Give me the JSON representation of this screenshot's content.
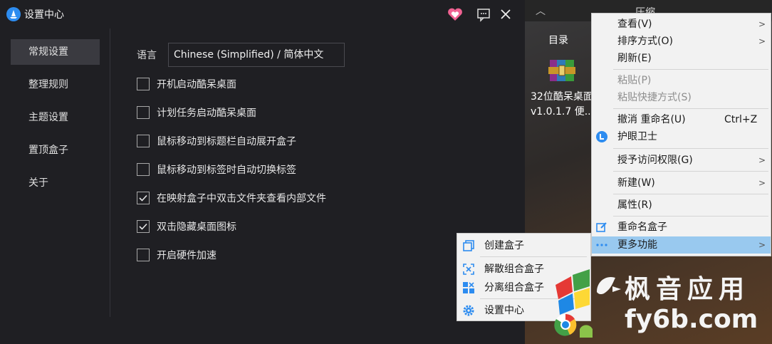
{
  "window": {
    "title": "设置中心"
  },
  "sidebar": {
    "items": [
      {
        "label": "常规设置",
        "active": true
      },
      {
        "label": "整理规则"
      },
      {
        "label": "主题设置"
      },
      {
        "label": "置顶盒子"
      },
      {
        "label": "关于"
      }
    ]
  },
  "settings": {
    "language_label": "语言",
    "language_value": "Chinese (Simplified) / 简体中文",
    "options": [
      {
        "label": "开机启动酷呆桌面",
        "checked": false
      },
      {
        "label": "计划任务启动酷呆桌面",
        "checked": false
      },
      {
        "label": "鼠标移动到标题栏自动展开盒子",
        "checked": false
      },
      {
        "label": "鼠标移动到标签时自动切换标签",
        "checked": false
      },
      {
        "label": "在映射盒子中双击文件夹查看内部文件",
        "checked": true
      },
      {
        "label": "双击隐藏桌面图标",
        "checked": true
      },
      {
        "label": "开启硬件加速",
        "checked": false
      }
    ]
  },
  "desktop": {
    "box_title": "压缩",
    "dir_label": "目录",
    "file_label_line1": "32位酷呆桌面",
    "file_label_line2": "v1.0.1.7 便..."
  },
  "context_menu": {
    "view": "查看(V)",
    "sort": "排序方式(O)",
    "refresh": "刷新(E)",
    "paste": "粘贴(P)",
    "paste_shortcut": "粘贴快捷方式(S)",
    "undo": "撤消 重命名(U)",
    "undo_shortcut": "Ctrl+Z",
    "eye_guard": "护眼卫士",
    "grant_access": "授予访问权限(G)",
    "new": "新建(W)",
    "properties": "属性(R)",
    "rename_box": "重命名盒子",
    "more": "更多功能"
  },
  "submenu": {
    "create_box": "创建盒子",
    "dissolve_group": "解散组合盒子",
    "separate_group": "分离组合盒子",
    "settings_center": "设置中心"
  },
  "watermark": {
    "line1": "枫音应用",
    "line2": "fy6b.com"
  },
  "colors": {
    "accent": "#2d8cf0",
    "highlight": "#99c9ef",
    "heart": "#f06292"
  }
}
